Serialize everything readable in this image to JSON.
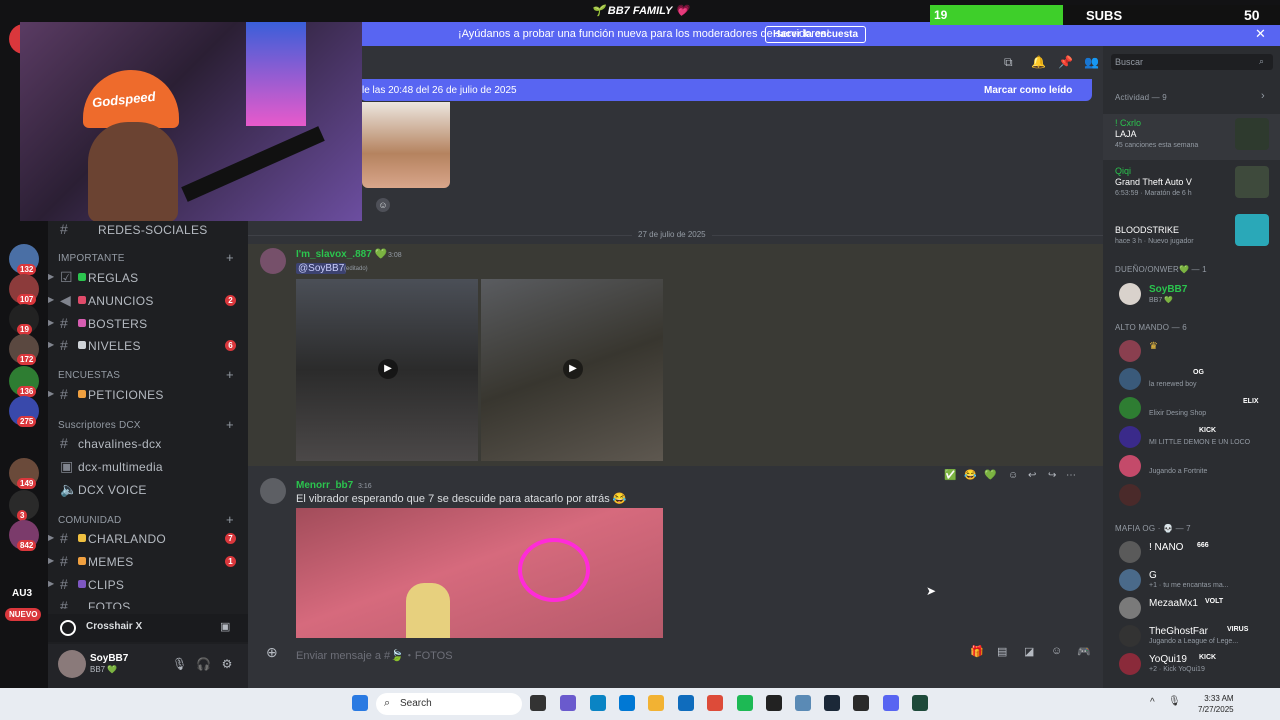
{
  "window": {
    "title": "🌱 BB7 FAMILY 💗"
  },
  "subs": {
    "current": "19",
    "label": "SUBS",
    "goal": "50",
    "progress_fraction": 0.38
  },
  "banner": {
    "text": "¡Ayúdanos a probar una función nueva para los moderadores de servidores!",
    "button": "Hacer la encuesta",
    "close": "✕"
  },
  "rail": {
    "badges": [
      "132",
      "107",
      "19",
      "172",
      "136",
      "275",
      "149",
      "3",
      "842"
    ],
    "au3": "AU3",
    "new": "NUEVO"
  },
  "channels": {
    "hidden_top": "REDES-SOCIALES",
    "categories": [
      "IMPORTANTE",
      "ENCUESTAS",
      "Suscriptores DCX",
      "COMUNIDAD"
    ],
    "items": [
      {
        "label": "REGLAS",
        "count": ""
      },
      {
        "label": "ANUNCIOS",
        "count": "2"
      },
      {
        "label": "BOSTERS",
        "count": ""
      },
      {
        "label": "NIVELES",
        "count": "6"
      },
      {
        "label": "PETICIONES",
        "count": ""
      },
      {
        "label": "chavalines-dcx",
        "count": ""
      },
      {
        "label": "dcx-multimedia",
        "count": ""
      },
      {
        "label": "DCX VOICE",
        "count": ""
      },
      {
        "label": "CHARLANDO",
        "count": "7"
      },
      {
        "label": "MEMES",
        "count": "1"
      },
      {
        "label": "CLIPS",
        "count": ""
      },
      {
        "label": "FOTOS",
        "count": ""
      }
    ]
  },
  "crosshair": {
    "label": "Crosshair X"
  },
  "user": {
    "name": "SoyBB7",
    "status": "BB7 💚"
  },
  "chat": {
    "new_messages": "le las 20:48 del 26 de julio de 2025",
    "mark_read": "Marcar como leído",
    "date_separator": "27 de julio de 2025",
    "msg1": {
      "author": "I'm_slavox_.887 💚",
      "time": "3:08",
      "mention": "@SoyBB7",
      "edited": "(editado)"
    },
    "msg2": {
      "author": "Menorr_bb7",
      "time": "3:16",
      "text": "El vibrador esperando que 7 se descuide para atacarlo por atrás 😂"
    },
    "input_placeholder": "Enviar mensaje a #🍃・FOTOS"
  },
  "right": {
    "search": "Buscar",
    "activity_header": "Actividad — 9",
    "activities": [
      {
        "user": "! Cxrlo",
        "title": "LAJA",
        "sub": "45 canciones esta semana"
      },
      {
        "user": "Qiqi",
        "title": "Grand Theft Auto V",
        "sub": "6:53:59 · Maratón de 6 h"
      },
      {
        "user": "",
        "title": "BLOODSTRIKE",
        "sub": "hace 3 h · Nuevo jugador"
      }
    ],
    "owner_header": "DUEÑO/ONWER💚 — 1",
    "owner": {
      "name": "SoyBB7",
      "sub": "BB7 💚"
    },
    "alto_header": "ALTO MANDO — 6",
    "alto": [
      {
        "name": "",
        "sub": "",
        "tag": ""
      },
      {
        "name": "",
        "sub": "la renewed boy",
        "tag": "OG"
      },
      {
        "name": "",
        "sub": "Elixir Desing Shop",
        "tag": "ELIX"
      },
      {
        "name": "",
        "sub": "MI LITTLE DEMON E UN LOCO",
        "tag": "KICK"
      },
      {
        "name": "",
        "sub": "Jugando a Fortnite",
        "tag": ""
      },
      {
        "name": "",
        "sub": "",
        "tag": ""
      }
    ],
    "mafia_header": "MAFIA OG · 💀 — 7",
    "mafia": [
      {
        "name": "! NANO",
        "sub": "",
        "tag": "666"
      },
      {
        "name": "G",
        "sub": "+1 · tu me encantas ma...",
        "tag": ""
      },
      {
        "name": "MezaaMx1",
        "sub": "",
        "tag": "VOLT"
      },
      {
        "name": "TheGhostFar",
        "sub": "Jugando a League of Lege...",
        "tag": "VIRUS"
      },
      {
        "name": "YoQui19",
        "sub": "+2 · Kick YoQui19",
        "tag": "KICK"
      }
    ]
  },
  "taskbar": {
    "search": "Search",
    "time": "3:33 AM",
    "date": "7/27/2025"
  },
  "colors": {
    "accent": "#5865f2",
    "green": "#2bc44e",
    "badge": "#da373c",
    "subs_bar": "#3ecf2a"
  }
}
